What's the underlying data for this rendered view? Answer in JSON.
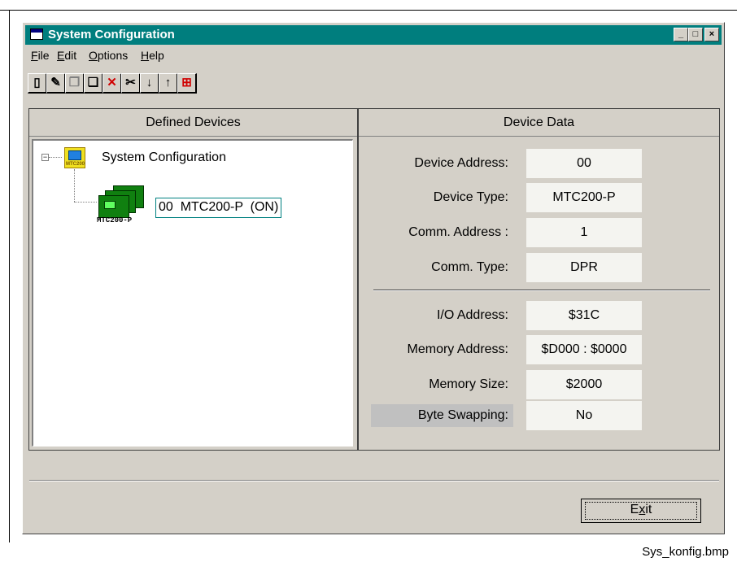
{
  "window": {
    "title": "System Configuration",
    "controls": [
      "_",
      "□",
      "×"
    ]
  },
  "menu": [
    {
      "accel": "F",
      "rest": "ile"
    },
    {
      "accel": "E",
      "rest": "dit"
    },
    {
      "accel": "O",
      "rest": "ptions"
    },
    {
      "accel": "H",
      "rest": "elp"
    }
  ],
  "toolbar": {
    "tools": [
      {
        "name": "new-icon",
        "glyph": "▯",
        "enabled": true
      },
      {
        "name": "edit-icon",
        "glyph": "✎",
        "enabled": true
      },
      {
        "name": "copy-disabled-icon",
        "glyph": "❐",
        "enabled": false
      },
      {
        "name": "paste-icon",
        "glyph": "❏",
        "enabled": true
      },
      {
        "name": "delete-icon",
        "glyph": "✕",
        "enabled": true
      },
      {
        "name": "cut-icon",
        "glyph": "✂",
        "enabled": true
      },
      {
        "name": "move-down-icon",
        "glyph": "↓",
        "enabled": true
      },
      {
        "name": "move-up-icon",
        "glyph": "↑",
        "enabled": true
      },
      {
        "name": "network-icon",
        "glyph": "⊞",
        "enabled": true
      }
    ]
  },
  "left_pane": {
    "header": "Defined Devices",
    "tree": {
      "root_label": "System Configuration",
      "root_icon_text": "MTC200",
      "device_label": "00  MTC200-P  (ON)",
      "device_caption": "MTC200-P"
    }
  },
  "right_pane": {
    "header": "Device Data",
    "rows": [
      {
        "label": "Device Address:",
        "value": "00"
      },
      {
        "label": "Device Type:",
        "value": "MTC200-P"
      },
      {
        "label": "Comm. Address :",
        "value": "1"
      },
      {
        "label": "Comm. Type:",
        "value": "DPR"
      },
      {
        "label": "I/O Address:",
        "value": "$31C"
      },
      {
        "label": "Memory Address:",
        "value": "$D000 : $0000"
      },
      {
        "label": "Memory Size:",
        "value": "$2000"
      },
      {
        "label": "Byte Swapping:",
        "value": "No",
        "highlighted": true
      }
    ]
  },
  "exit_button": {
    "accel": "x",
    "pre": "E",
    "post": "it"
  },
  "caption": "Sys_konfig.bmp",
  "colors": {
    "titlebar": "#007e7e",
    "dialog": "#d4d0c8",
    "value_box": "#f4f4f0"
  }
}
